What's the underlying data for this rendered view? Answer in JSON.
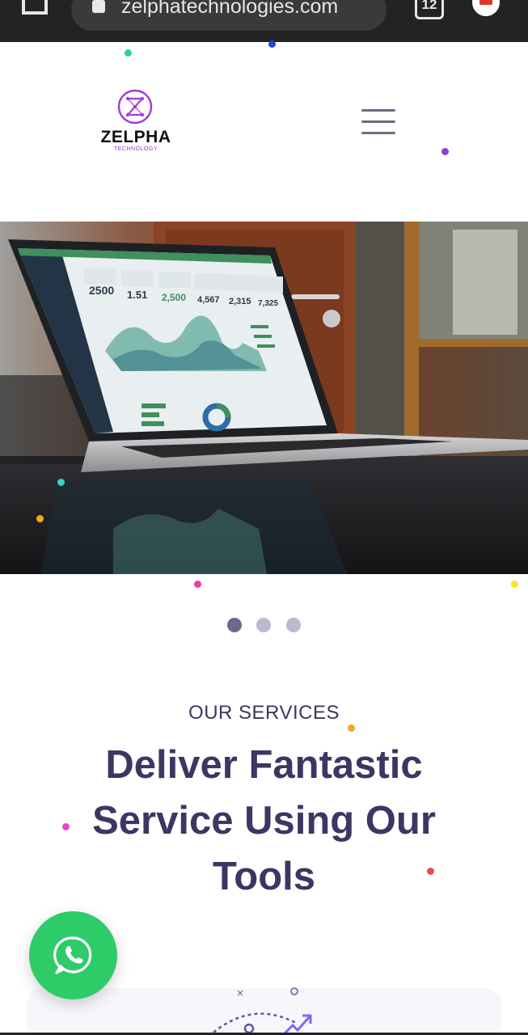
{
  "browser": {
    "url": "zelphatechnologies.com",
    "tab_count": "12"
  },
  "header": {
    "logo_name": "ZELPHA",
    "logo_tagline": "TECHNOLOGY"
  },
  "hero": {
    "image": "laptop-dashboard-photo",
    "dashboard_stats": [
      "2500",
      "1.51",
      "2,500",
      "4,567",
      "2,315",
      "7,325"
    ]
  },
  "carousel": {
    "slide_count": 3,
    "active_index": 0
  },
  "services": {
    "kicker": "OUR SERVICES",
    "heading": "Deliver Fantastic Service Using Our Tools"
  },
  "colors": {
    "heading": "#3b3763",
    "brand_purple": "#8e3fd0",
    "whatsapp_green": "#2ecc68",
    "dot_active": "#6a6a8e",
    "dot_inactive": "#b9b9cf"
  },
  "icons": {
    "home": "home-icon",
    "lock": "lock-icon",
    "menu": "hamburger-icon",
    "whatsapp": "whatsapp-icon"
  }
}
